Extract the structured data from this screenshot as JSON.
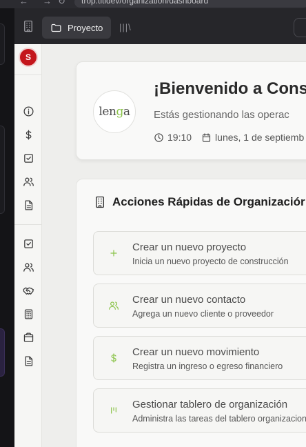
{
  "browser": {
    "url": "trop.titldev/organization/dashboard"
  },
  "header": {
    "project_tab_label": "Proyecto"
  },
  "user": {
    "avatar_initial": "S"
  },
  "welcome": {
    "title": "¡Bienvenido a Cons",
    "subtitle": "Estás gestionando las operac",
    "time": "19:10",
    "date": "lunes, 1 de septiemb",
    "logo_text_start": "len",
    "logo_text_leaf": "g",
    "logo_text_end": "a"
  },
  "quick_actions": {
    "title": "Acciones Rápidas de Organizaciór",
    "items": [
      {
        "title": "Crear un nuevo proyecto",
        "description": "Inicia un nuevo proyecto de construcción",
        "icon": "plus-icon"
      },
      {
        "title": "Crear un nuevo contacto",
        "description": "Agrega un nuevo cliente o proveedor",
        "icon": "users-icon"
      },
      {
        "title": "Crear un nuevo movimiento",
        "description": "Registra un ingreso o egreso financiero",
        "icon": "dollar-icon"
      },
      {
        "title": "Gestionar tablero de organización",
        "description": "Administra las tareas del tablero organizacion",
        "icon": "kanban-icon"
      }
    ]
  },
  "colors": {
    "accent": "#8bc34a",
    "avatar": "#c4161c",
    "header_bg": "#26262a"
  }
}
